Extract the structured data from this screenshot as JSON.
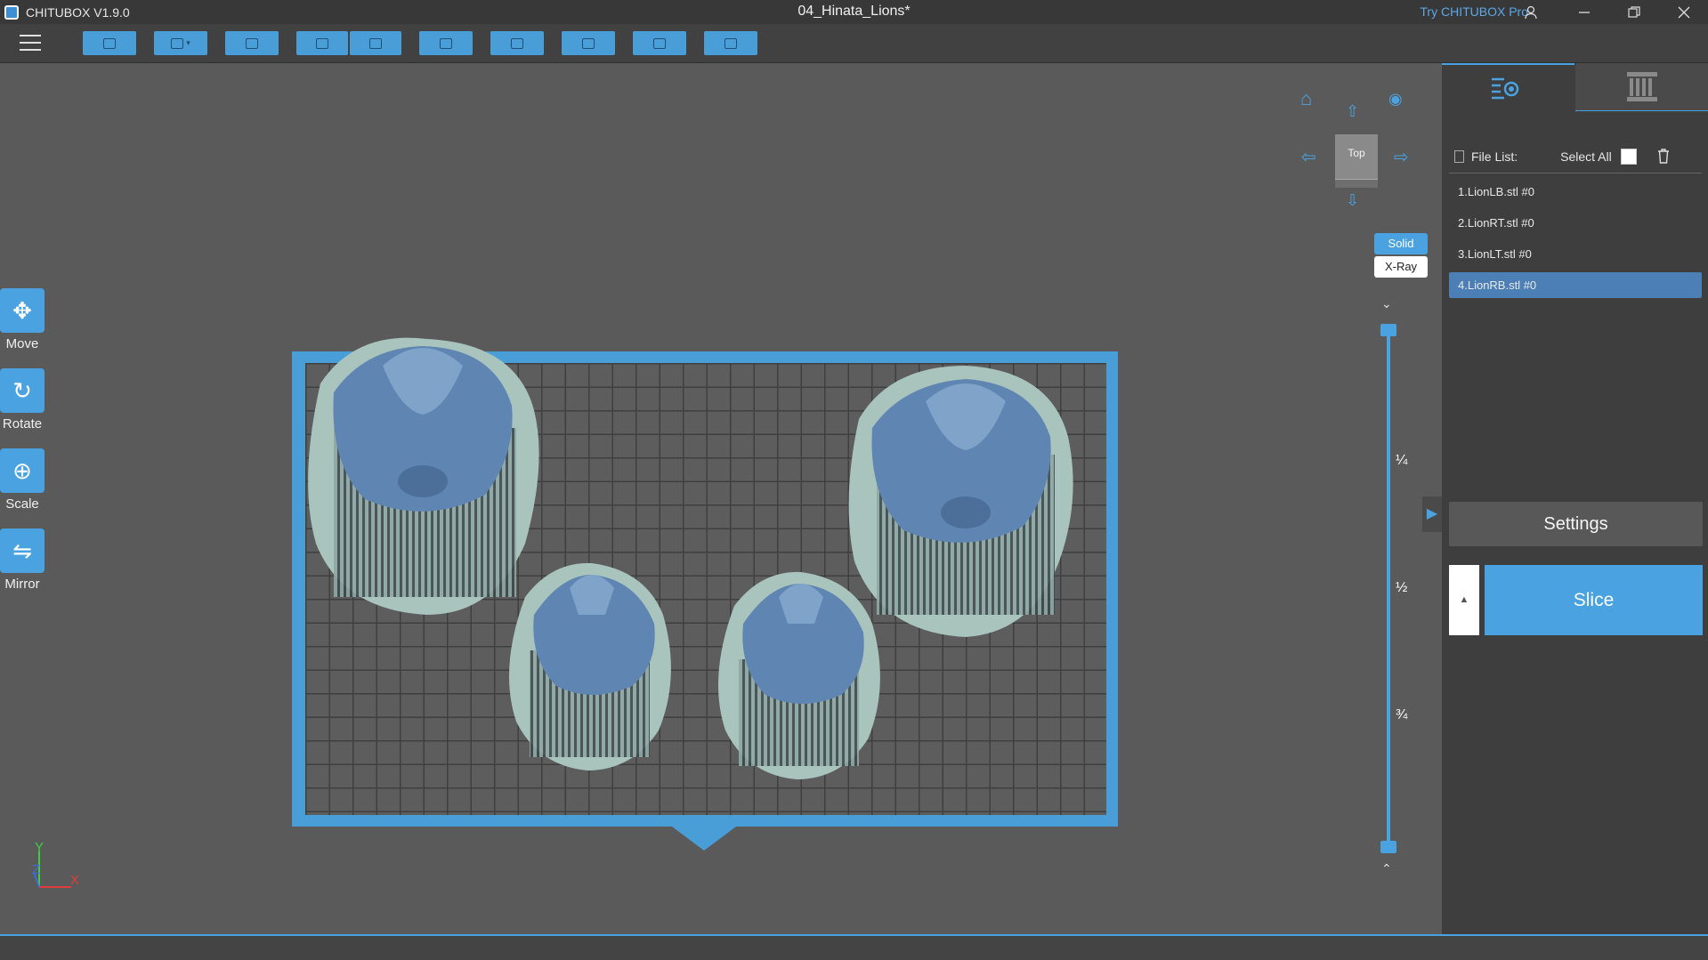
{
  "titlebar": {
    "app_name": "CHITUBOX V1.9.0",
    "document_title": "04_Hinata_Lions*",
    "try_pro": "Try CHITUBOX Pro",
    "icons": [
      "user-icon",
      "minimize-icon",
      "restore-icon",
      "close-icon"
    ]
  },
  "toolbar": {
    "buttons": [
      "open-file-icon",
      "save-icon",
      "auto-layout-icon",
      "undo-icon",
      "redo-icon",
      "paste-icon",
      "duplicate-icon",
      "hollow-icon",
      "drill-hole-icon",
      "settings-icon"
    ]
  },
  "left_tools": [
    {
      "label": "Move",
      "icon": "move-icon",
      "glyph": "✥"
    },
    {
      "label": "Rotate",
      "icon": "rotate-icon",
      "glyph": "↻"
    },
    {
      "label": "Scale",
      "icon": "scale-icon",
      "glyph": "⊕"
    },
    {
      "label": "Mirror",
      "icon": "mirror-icon",
      "glyph": "⇋"
    }
  ],
  "view": {
    "cube_label": "Top",
    "mode_solid": "Solid",
    "mode_xray": "X-Ray"
  },
  "layer_slider": {
    "marks": [
      "¼",
      "½",
      "¾"
    ]
  },
  "axes": {
    "x": "X",
    "y": "Y",
    "z": "Z"
  },
  "right_panel": {
    "file_list_label": "File List:",
    "select_all_label": "Select All",
    "files": [
      "1.LionLB.stl #0",
      "2.LionRT.stl #0",
      "3.LionLT.stl #0",
      "4.LionRB.stl #0"
    ],
    "selected_index": 3,
    "settings_label": "Settings",
    "slice_label": "Slice"
  },
  "colors": {
    "accent": "#4aa3e0",
    "model": "#5f86b2",
    "raft": "#a9c3bd",
    "plate": "#5a5a5a"
  }
}
